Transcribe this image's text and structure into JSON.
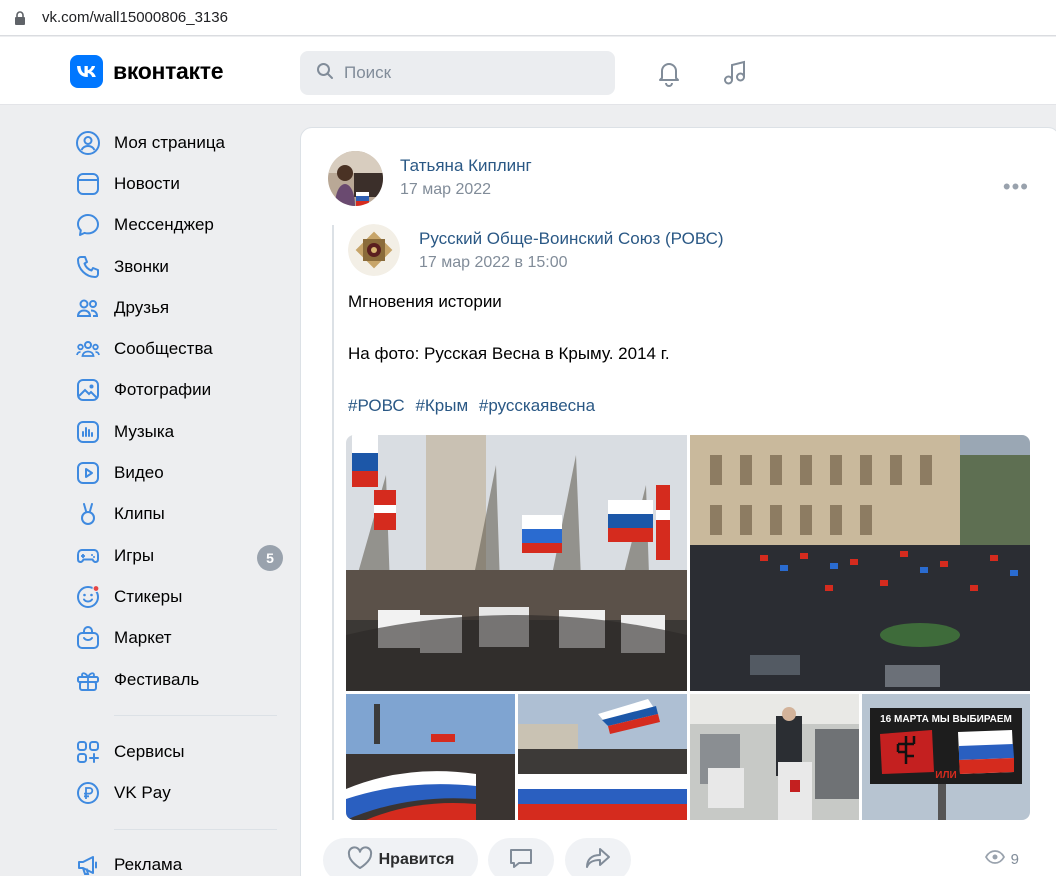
{
  "browser": {
    "url": "vk.com/wall15000806_3136"
  },
  "header": {
    "logo_text": "вконтакте",
    "search_placeholder": "Поиск",
    "accent": "#0077ff"
  },
  "sidebar": {
    "items": [
      {
        "label": "Моя страница",
        "icon": "user-circle-icon"
      },
      {
        "label": "Новости",
        "icon": "news-icon"
      },
      {
        "label": "Мессенджер",
        "icon": "chat-bubble-icon"
      },
      {
        "label": "Звонки",
        "icon": "phone-icon"
      },
      {
        "label": "Друзья",
        "icon": "friends-icon"
      },
      {
        "label": "Сообщества",
        "icon": "communities-icon"
      },
      {
        "label": "Фотографии",
        "icon": "photo-icon"
      },
      {
        "label": "Музыка",
        "icon": "music-icon"
      },
      {
        "label": "Видео",
        "icon": "video-icon"
      },
      {
        "label": "Клипы",
        "icon": "clips-icon"
      },
      {
        "label": "Игры",
        "icon": "gamepad-icon",
        "badge": "5"
      },
      {
        "label": "Стикеры",
        "icon": "sticker-icon"
      },
      {
        "label": "Маркет",
        "icon": "market-bag-icon"
      },
      {
        "label": "Фестиваль",
        "icon": "gift-icon"
      }
    ],
    "secondary": [
      {
        "label": "Сервисы",
        "icon": "services-grid-icon"
      },
      {
        "label": "VK Pay",
        "icon": "vkpay-ruble-icon"
      }
    ],
    "tertiary": [
      {
        "label": "Реклама",
        "icon": "megaphone-icon"
      }
    ]
  },
  "post": {
    "author": "Татьяна Киплинг",
    "date": "17 мар 2022",
    "repost": {
      "source_name": "Русский Обще-Воинский Союз (РОВС)",
      "source_date": "17 мар 2022 в 15:00",
      "text_line1": "Мгновения истории",
      "text_line2": "На фото: Русская Весна в Крыму. 2014 г.",
      "hashtags": [
        "#РОВС",
        "#Крым",
        "#русскаявесна"
      ]
    },
    "photo_captions": {
      "billboard_top": "16 МАРТА МЫ ВЫБИРАЕМ",
      "billboard_bottom": "ИЛИ"
    },
    "actions": {
      "like_label": "Нравится",
      "views": "9"
    }
  }
}
